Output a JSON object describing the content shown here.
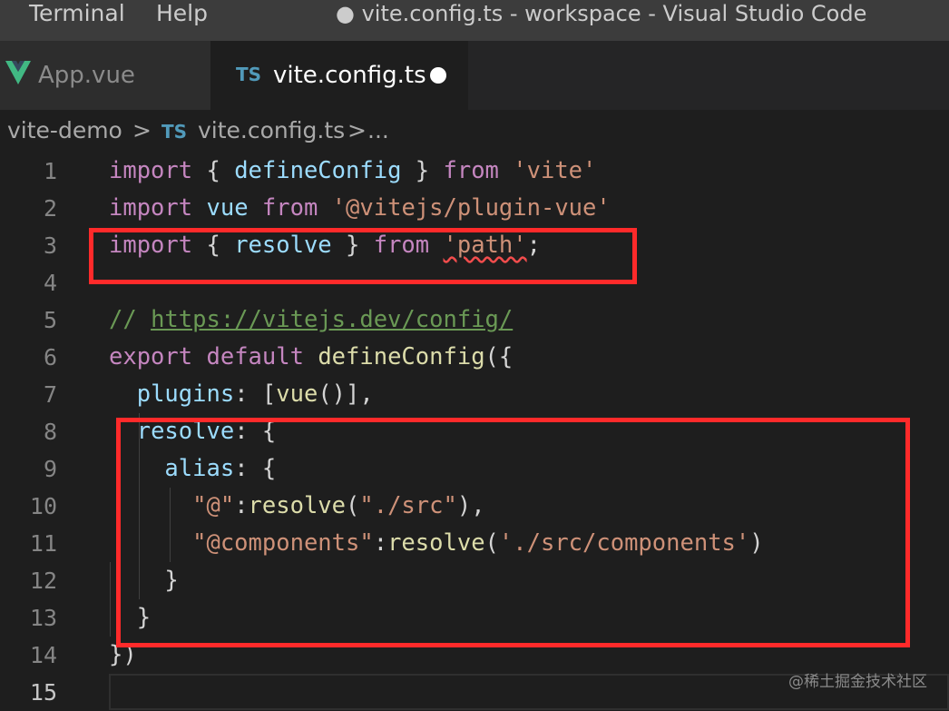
{
  "menu": {
    "items": [
      "Terminal",
      "Help"
    ]
  },
  "window_title": "● vite.config.ts - workspace - Visual Studio Code",
  "tabs": [
    {
      "label": "App.vue",
      "icon": "vue-icon",
      "active": false
    },
    {
      "label": "vite.config.ts",
      "icon": "ts-icon",
      "icon_text": "TS",
      "active": true,
      "dirty": true
    }
  ],
  "breadcrumb": {
    "folder": "vite-demo",
    "sep": ">",
    "file_icon": "TS",
    "file": "vite.config.ts",
    "more": "..."
  },
  "editor": {
    "current_line": 15,
    "lines": [
      {
        "n": "1",
        "tokens": [
          [
            "kw",
            "import"
          ],
          [
            "pn",
            " { "
          ],
          [
            "vr",
            "defineConfig"
          ],
          [
            "pn",
            " } "
          ],
          [
            "kw",
            "from"
          ],
          [
            "pn",
            " "
          ],
          [
            "st",
            "'vite'"
          ]
        ]
      },
      {
        "n": "2",
        "tokens": [
          [
            "kw",
            "import"
          ],
          [
            "pn",
            " "
          ],
          [
            "vr",
            "vue"
          ],
          [
            "pn",
            " "
          ],
          [
            "kw",
            "from"
          ],
          [
            "pn",
            " "
          ],
          [
            "st",
            "'@vitejs/plugin-vue'"
          ]
        ]
      },
      {
        "n": "3",
        "tokens": [
          [
            "kw",
            "import"
          ],
          [
            "pn",
            " { "
          ],
          [
            "vr",
            "resolve"
          ],
          [
            "pn",
            " } "
          ],
          [
            "kw",
            "from"
          ],
          [
            "pn",
            " "
          ],
          [
            "st squig",
            "'path'"
          ],
          [
            "pn",
            ";"
          ]
        ]
      },
      {
        "n": "4",
        "tokens": []
      },
      {
        "n": "5",
        "tokens": [
          [
            "cm",
            "// "
          ],
          [
            "url",
            "https://vitejs.dev/config/"
          ]
        ]
      },
      {
        "n": "6",
        "tokens": [
          [
            "kw",
            "export"
          ],
          [
            "pn",
            " "
          ],
          [
            "kw",
            "default"
          ],
          [
            "pn",
            " "
          ],
          [
            "fn",
            "defineConfig"
          ],
          [
            "pn",
            "({"
          ]
        ]
      },
      {
        "n": "7",
        "tokens": [
          [
            "pn",
            "  "
          ],
          [
            "vr",
            "plugins"
          ],
          [
            "pn",
            ": ["
          ],
          [
            "fn",
            "vue"
          ],
          [
            "pn",
            "()],"
          ]
        ]
      },
      {
        "n": "8",
        "tokens": [
          [
            "pn",
            "  "
          ],
          [
            "vr",
            "resolve"
          ],
          [
            "pn",
            ": {"
          ]
        ]
      },
      {
        "n": "9",
        "tokens": [
          [
            "pn",
            "    "
          ],
          [
            "vr",
            "alias"
          ],
          [
            "pn",
            ": {"
          ]
        ]
      },
      {
        "n": "10",
        "tokens": [
          [
            "pn",
            "      "
          ],
          [
            "st",
            "\"@\""
          ],
          [
            "pn",
            ":"
          ],
          [
            "fn",
            "resolve"
          ],
          [
            "pn",
            "("
          ],
          [
            "st",
            "\"./src\""
          ],
          [
            "pn",
            "),"
          ]
        ]
      },
      {
        "n": "11",
        "tokens": [
          [
            "pn",
            "      "
          ],
          [
            "st",
            "\"@components\""
          ],
          [
            "pn",
            ":"
          ],
          [
            "fn",
            "resolve"
          ],
          [
            "pn",
            "("
          ],
          [
            "st",
            "'./src/components'"
          ],
          [
            "pn",
            ")"
          ]
        ]
      },
      {
        "n": "12",
        "tokens": [
          [
            "pn",
            "    }"
          ]
        ]
      },
      {
        "n": "13",
        "tokens": [
          [
            "pn",
            "  }"
          ]
        ]
      },
      {
        "n": "14",
        "tokens": [
          [
            "pn",
            "})"
          ]
        ]
      },
      {
        "n": "15",
        "tokens": []
      }
    ]
  },
  "watermark": "@稀土掘金技术社区",
  "colors": {
    "keyword": "#c586c0",
    "string": "#ce9178",
    "variable": "#9cdcfe",
    "function": "#dcdcaa",
    "comment": "#6a9955",
    "highlight_box": "#ff2a2a"
  }
}
